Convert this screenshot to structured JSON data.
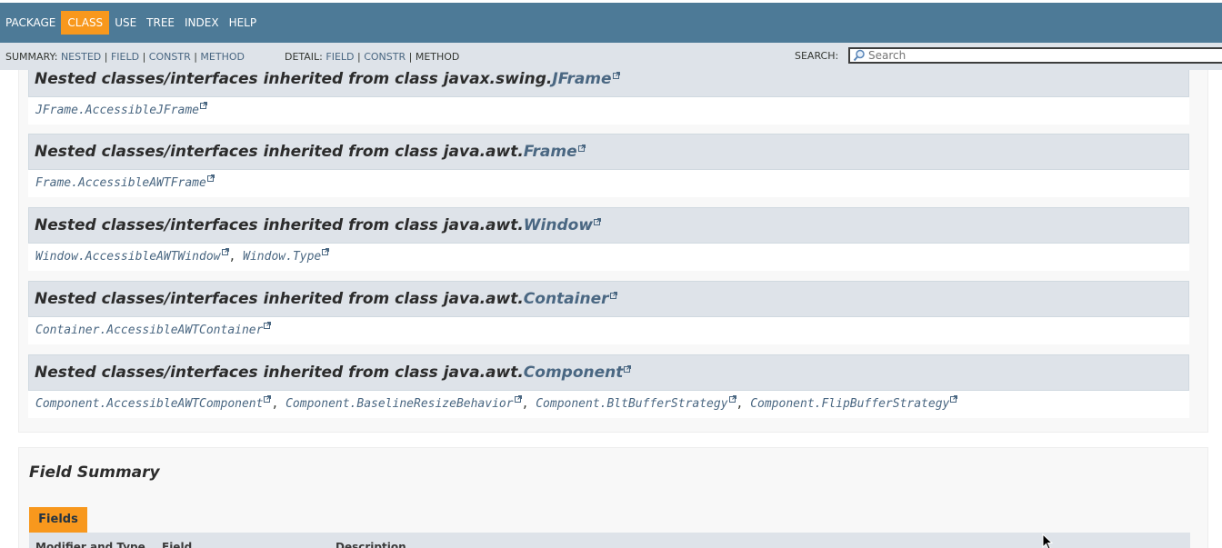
{
  "topnav": {
    "items": [
      {
        "label": "PACKAGE",
        "active": false
      },
      {
        "label": "CLASS",
        "active": true
      },
      {
        "label": "USE",
        "active": false
      },
      {
        "label": "TREE",
        "active": false
      },
      {
        "label": "INDEX",
        "active": false
      },
      {
        "label": "HELP",
        "active": false
      }
    ],
    "active_color": "#f8981d",
    "bar_color": "#4d7a97"
  },
  "subnav": {
    "summary_label": "SUMMARY:",
    "summary_links": [
      "NESTED",
      "FIELD",
      "CONSTR",
      "METHOD"
    ],
    "summary_method_inactive": "METHOD",
    "detail_label": "DETAIL:",
    "detail_links": [
      "FIELD",
      "CONSTR"
    ],
    "detail_method_inactive": "METHOD",
    "separator": " | ",
    "search_label": "SEARCH:",
    "search_placeholder": "Search"
  },
  "inherited": [
    {
      "prefix": "Nested classes/interfaces inherited from class javax.swing.",
      "class_link": "JFrame",
      "members": [
        "JFrame.AccessibleJFrame"
      ]
    },
    {
      "prefix": "Nested classes/interfaces inherited from class java.awt.",
      "class_link": "Frame",
      "members": [
        "Frame.AccessibleAWTFrame"
      ]
    },
    {
      "prefix": "Nested classes/interfaces inherited from class java.awt.",
      "class_link": "Window",
      "members": [
        "Window.AccessibleAWTWindow",
        "Window.Type"
      ]
    },
    {
      "prefix": "Nested classes/interfaces inherited from class java.awt.",
      "class_link": "Container",
      "members": [
        "Container.AccessibleAWTContainer"
      ]
    },
    {
      "prefix": "Nested classes/interfaces inherited from class java.awt.",
      "class_link": "Component",
      "members": [
        "Component.AccessibleAWTComponent",
        "Component.BaselineResizeBehavior",
        "Component.BltBufferStrategy",
        "Component.FlipBufferStrategy"
      ]
    }
  ],
  "field_summary": {
    "title": "Field Summary",
    "tab": "Fields",
    "columns": [
      "Modifier and Type",
      "Field",
      "Description"
    ]
  },
  "icons": {
    "external": "external-link-icon",
    "search": "magnifier-icon",
    "cursor": "mouse-pointer-icon"
  },
  "colors": {
    "link": "#4a6782",
    "header_bg": "#dee3e9"
  }
}
